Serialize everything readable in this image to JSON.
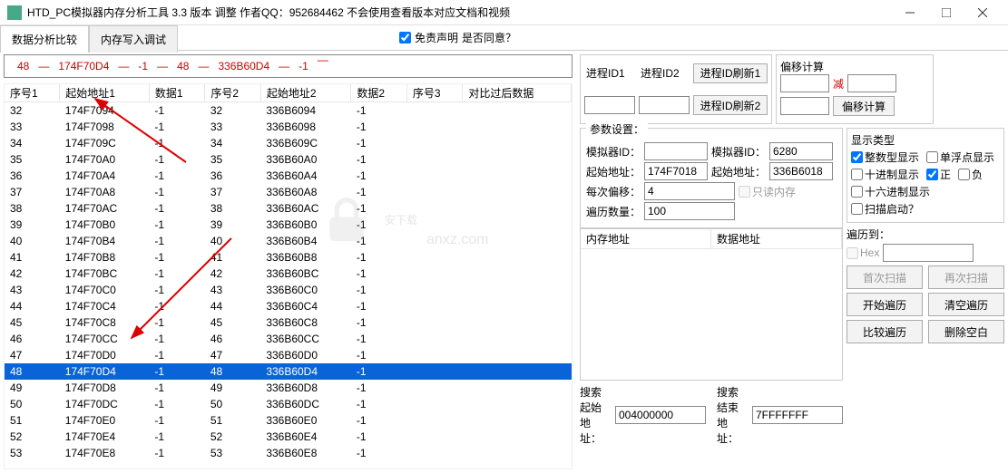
{
  "title": "HTD_PC模拟器内存分析工具  3.3 版本 调整 作者QQ：952684462 不会使用查看版本对应文档和视频",
  "tabs": {
    "data_compare": "数据分析比较",
    "mem_write": "内存写入调试"
  },
  "disclaimer": {
    "label": "免责声明",
    "question": "是否同意？"
  },
  "redline": {
    "a": "48",
    "b": "174F70D4",
    "c": "-1",
    "d": "48",
    "e": "336B60D4",
    "f": "-1"
  },
  "columns": {
    "seq1": "序号1",
    "addr1": "起始地址1",
    "data1": "数据1",
    "seq2": "序号2",
    "addr2": "起始地址2",
    "data2": "数据2",
    "seq3": "序号3",
    "cmp": "对比过后数据"
  },
  "rows": [
    {
      "s1": "32",
      "a1": "174F7094",
      "d1": "-1",
      "s2": "32",
      "a2": "336B6094",
      "d2": "-1",
      "sel": false
    },
    {
      "s1": "33",
      "a1": "174F7098",
      "d1": "-1",
      "s2": "33",
      "a2": "336B6098",
      "d2": "-1",
      "sel": false
    },
    {
      "s1": "34",
      "a1": "174F709C",
      "d1": "-1",
      "s2": "34",
      "a2": "336B609C",
      "d2": "-1",
      "sel": false
    },
    {
      "s1": "35",
      "a1": "174F70A0",
      "d1": "-1",
      "s2": "35",
      "a2": "336B60A0",
      "d2": "-1",
      "sel": false
    },
    {
      "s1": "36",
      "a1": "174F70A4",
      "d1": "-1",
      "s2": "36",
      "a2": "336B60A4",
      "d2": "-1",
      "sel": false
    },
    {
      "s1": "37",
      "a1": "174F70A8",
      "d1": "-1",
      "s2": "37",
      "a2": "336B60A8",
      "d2": "-1",
      "sel": false
    },
    {
      "s1": "38",
      "a1": "174F70AC",
      "d1": "-1",
      "s2": "38",
      "a2": "336B60AC",
      "d2": "-1",
      "sel": false
    },
    {
      "s1": "39",
      "a1": "174F70B0",
      "d1": "-1",
      "s2": "39",
      "a2": "336B60B0",
      "d2": "-1",
      "sel": false
    },
    {
      "s1": "40",
      "a1": "174F70B4",
      "d1": "-1",
      "s2": "40",
      "a2": "336B60B4",
      "d2": "-1",
      "sel": false
    },
    {
      "s1": "41",
      "a1": "174F70B8",
      "d1": "-1",
      "s2": "41",
      "a2": "336B60B8",
      "d2": "-1",
      "sel": false
    },
    {
      "s1": "42",
      "a1": "174F70BC",
      "d1": "-1",
      "s2": "42",
      "a2": "336B60BC",
      "d2": "-1",
      "sel": false
    },
    {
      "s1": "43",
      "a1": "174F70C0",
      "d1": "-1",
      "s2": "43",
      "a2": "336B60C0",
      "d2": "-1",
      "sel": false
    },
    {
      "s1": "44",
      "a1": "174F70C4",
      "d1": "-1",
      "s2": "44",
      "a2": "336B60C4",
      "d2": "-1",
      "sel": false
    },
    {
      "s1": "45",
      "a1": "174F70C8",
      "d1": "-1",
      "s2": "45",
      "a2": "336B60C8",
      "d2": "-1",
      "sel": false
    },
    {
      "s1": "46",
      "a1": "174F70CC",
      "d1": "-1",
      "s2": "46",
      "a2": "336B60CC",
      "d2": "-1",
      "sel": false
    },
    {
      "s1": "47",
      "a1": "174F70D0",
      "d1": "-1",
      "s2": "47",
      "a2": "336B60D0",
      "d2": "-1",
      "sel": false
    },
    {
      "s1": "48",
      "a1": "174F70D4",
      "d1": "-1",
      "s2": "48",
      "a2": "336B60D4",
      "d2": "-1",
      "sel": true
    },
    {
      "s1": "49",
      "a1": "174F70D8",
      "d1": "-1",
      "s2": "49",
      "a2": "336B60D8",
      "d2": "-1",
      "sel": false
    },
    {
      "s1": "50",
      "a1": "174F70DC",
      "d1": "-1",
      "s2": "50",
      "a2": "336B60DC",
      "d2": "-1",
      "sel": false
    },
    {
      "s1": "51",
      "a1": "174F70E0",
      "d1": "-1",
      "s2": "51",
      "a2": "336B60E0",
      "d2": "-1",
      "sel": false
    },
    {
      "s1": "52",
      "a1": "174F70E4",
      "d1": "-1",
      "s2": "52",
      "a2": "336B60E4",
      "d2": "-1",
      "sel": false
    },
    {
      "s1": "53",
      "a1": "174F70E8",
      "d1": "-1",
      "s2": "53",
      "a2": "336B60E8",
      "d2": "-1",
      "sel": false
    }
  ],
  "pid": {
    "lbl1": "进程ID1",
    "lbl2": "进程ID2",
    "refresh1": "进程ID刷新1",
    "refresh2": "进程ID刷新2"
  },
  "params": {
    "legend": "参数设置：",
    "simid_lbl": "模拟器ID：",
    "simid2_lbl": "模拟器ID：",
    "simid2_val": "6280",
    "start_lbl": "起始地址：",
    "start1_val": "174F7018",
    "start2_lbl": "起始地址：",
    "start2_val": "336B6018",
    "offset_lbl": "每次偏移：",
    "offset_val": "4",
    "readonly_lbl": "只读内存",
    "count_lbl": "遍历数量：",
    "count_val": "100"
  },
  "memlist": {
    "col1": "内存地址",
    "col2": "数据地址"
  },
  "offsetcalc": {
    "legend": "偏移计算",
    "minus": "减",
    "btn": "偏移计算"
  },
  "disp": {
    "legend": "显示类型",
    "int": "整数型显示",
    "float": "单浮点显示",
    "dec": "十进制显示",
    "pos": "正",
    "neg": "负",
    "hex16": "十六进制显示",
    "scan": "扫描启动？"
  },
  "traverse": {
    "to": "遍历到：",
    "hex": "Hex",
    "first": "首次扫描",
    "again": "再次扫描",
    "start": "开始遍历",
    "clear": "清空遍历",
    "cmp": "比较遍历",
    "delblank": "删除空白"
  },
  "search": {
    "start_lbl": "搜索起始地址：",
    "start_val": "004000000",
    "end_lbl": "搜索结束地址：",
    "end_val": "7FFFFFFF"
  },
  "watermark": "安下载"
}
